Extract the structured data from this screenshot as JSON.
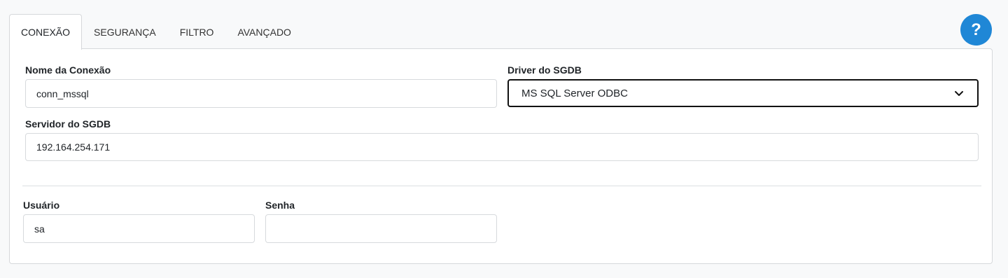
{
  "tabs": [
    {
      "label": "CONEXÃO",
      "active": true
    },
    {
      "label": "SEGURANÇA",
      "active": false
    },
    {
      "label": "FILTRO",
      "active": false
    },
    {
      "label": "AVANÇADO",
      "active": false
    }
  ],
  "help": {
    "label": "?"
  },
  "form": {
    "connection_name": {
      "label": "Nome da Conexão",
      "value": "conn_mssql"
    },
    "driver": {
      "label": "Driver do SGDB",
      "value": "MS SQL Server ODBC"
    },
    "server": {
      "label": "Servidor do SGDB",
      "value": "192.164.254.171"
    },
    "user": {
      "label": "Usuário",
      "value": "sa"
    },
    "password": {
      "label": "Senha",
      "value": ""
    }
  },
  "colors": {
    "accent": "#1f87d6",
    "border": "#d7dadd"
  }
}
